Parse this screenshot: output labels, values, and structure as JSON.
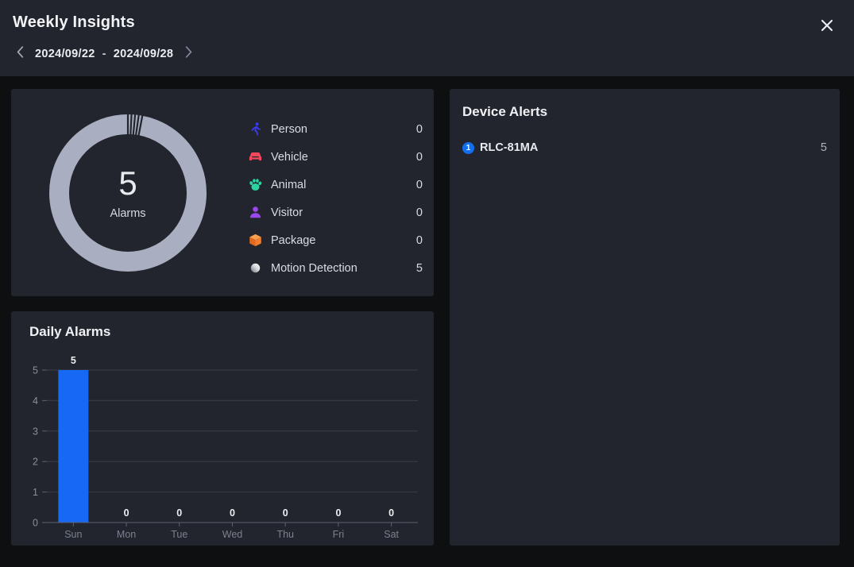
{
  "header": {
    "title": "Weekly Insights",
    "close_icon": "close-icon",
    "prev_icon": "chevron-left-icon",
    "next_icon": "chevron-right-icon",
    "date_start": "2024/09/22",
    "date_separator": "-",
    "date_end": "2024/09/28"
  },
  "overview": {
    "total": "5",
    "total_label": "Alarms",
    "donut_color": "#a9aec0",
    "legend": [
      {
        "icon": "person-icon",
        "label": "Person",
        "value": "0",
        "color": "#3a3af0"
      },
      {
        "icon": "vehicle-icon",
        "label": "Vehicle",
        "value": "0",
        "color": "#f2475c"
      },
      {
        "icon": "animal-icon",
        "label": "Animal",
        "value": "0",
        "color": "#2ad3a0"
      },
      {
        "icon": "visitor-icon",
        "label": "Visitor",
        "value": "0",
        "color": "#9a47ee"
      },
      {
        "icon": "package-icon",
        "label": "Package",
        "value": "0",
        "color": "#ef7f2e"
      },
      {
        "icon": "motion-icon",
        "label": "Motion Detection",
        "value": "5",
        "color": "#e8e8ea"
      }
    ]
  },
  "daily": {
    "title": "Daily Alarms",
    "bar_color": "#1668f5"
  },
  "chart_data": {
    "type": "bar",
    "title": "Daily Alarms",
    "categories": [
      "Sun",
      "Mon",
      "Tue",
      "Wed",
      "Thu",
      "Fri",
      "Sat"
    ],
    "values": [
      5,
      0,
      0,
      0,
      0,
      0,
      0
    ],
    "data_labels": [
      "5",
      "0",
      "0",
      "0",
      "0",
      "0",
      "0"
    ],
    "yticks": [
      "0",
      "1",
      "2",
      "3",
      "4",
      "5"
    ],
    "ylim": [
      0,
      5
    ],
    "xlabel": "",
    "ylabel": "",
    "grid": true,
    "legend": "none"
  },
  "device_alerts": {
    "title": "Device Alerts",
    "items": [
      {
        "badge": "1",
        "name": "RLC-81MA",
        "count": "5",
        "badge_color": "#1270f0"
      }
    ]
  }
}
